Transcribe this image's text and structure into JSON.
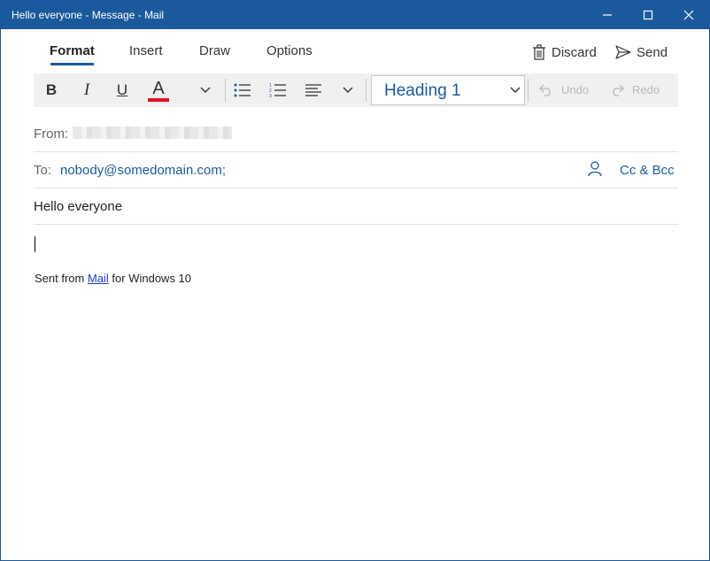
{
  "window": {
    "title": "Hello everyone - Message - Mail",
    "controls": [
      "minimize-icon",
      "maximize-icon",
      "close-icon"
    ]
  },
  "ribbon": {
    "tabs": [
      {
        "label": "Format",
        "active": true
      },
      {
        "label": "Insert",
        "active": false
      },
      {
        "label": "Draw",
        "active": false
      },
      {
        "label": "Options",
        "active": false
      }
    ],
    "discard_label": "Discard",
    "send_label": "Send"
  },
  "toolbar": {
    "bold": "B",
    "italic": "I",
    "underline": "U",
    "font_color": "A",
    "font_color_hex": "#e81123",
    "heading_style": "Heading 1",
    "undo_label": "Undo",
    "redo_label": "Redo"
  },
  "fields": {
    "from_label": "From:",
    "to_label": "To:",
    "to_value": "nobody@somedomain.com;",
    "cc_bcc_label": "Cc & Bcc",
    "subject": "Hello everyone"
  },
  "body": {
    "signature_prefix": "Sent from ",
    "signature_link": "Mail",
    "signature_suffix": " for Windows 10"
  },
  "colors": {
    "accent": "#1a5a9c",
    "link": "#1a3fc9"
  }
}
